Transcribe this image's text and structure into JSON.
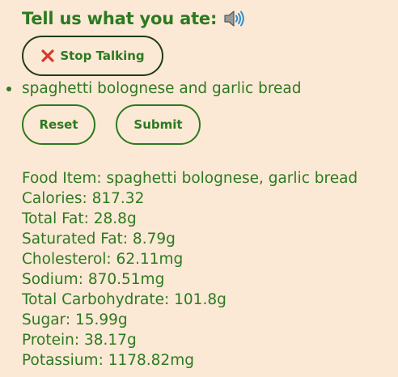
{
  "header": {
    "title": "Tell us what you ate:",
    "icon": "speaker-icon"
  },
  "controls": {
    "stop_label": "Stop Talking",
    "stop_icon": "close-x-icon",
    "reset_label": "Reset",
    "submit_label": "Submit"
  },
  "transcript": {
    "items": [
      "spaghetti bolognese and garlic bread"
    ]
  },
  "nutrition": [
    {
      "label": "Food Item",
      "value": "spaghetti bolognese, garlic bread"
    },
    {
      "label": "Calories",
      "value": "817.32"
    },
    {
      "label": "Total Fat",
      "value": "28.8g"
    },
    {
      "label": "Saturated Fat",
      "value": "8.79g"
    },
    {
      "label": "Cholesterol",
      "value": "62.11mg"
    },
    {
      "label": "Sodium",
      "value": "870.51mg"
    },
    {
      "label": "Total Carbohydrate",
      "value": "101.8g"
    },
    {
      "label": "Sugar",
      "value": "15.99g"
    },
    {
      "label": "Protein",
      "value": "38.17g"
    },
    {
      "label": "Potassium",
      "value": "1178.82mg"
    }
  ],
  "colors": {
    "background": "#fbe9d6",
    "accent_green": "#2d7a1f",
    "dark_border": "#1e3d14",
    "stop_icon_red": "#d9362b",
    "speaker_blue": "#2b8fd6"
  }
}
